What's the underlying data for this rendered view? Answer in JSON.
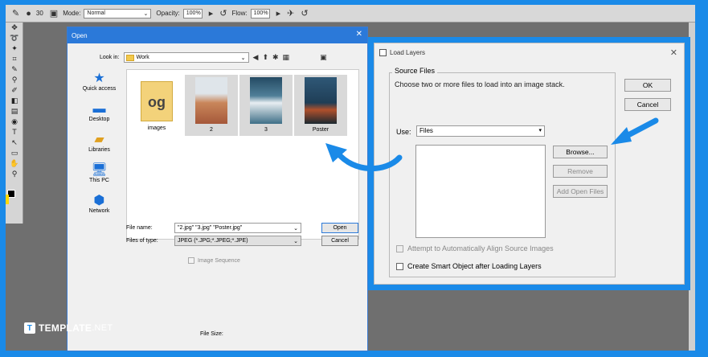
{
  "optbar": {
    "brush_size": "30",
    "mode_label": "Mode:",
    "mode_value": "Normal",
    "opacity_label": "Opacity:",
    "opacity_value": "100%",
    "flow_label": "Flow:",
    "flow_value": "100%"
  },
  "open_dialog": {
    "title": "Open",
    "close_glyph": "✕",
    "look_in_label": "Look in:",
    "look_in_value": "Work",
    "places": [
      {
        "label": "Quick access",
        "icon": "star-icon"
      },
      {
        "label": "Desktop",
        "icon": "desktop-icon"
      },
      {
        "label": "Libraries",
        "icon": "libraries-icon"
      },
      {
        "label": "This PC",
        "icon": "pc-icon"
      },
      {
        "label": "Network",
        "icon": "network-icon"
      }
    ],
    "files": [
      {
        "name": "images",
        "type": "folder"
      },
      {
        "name": "2",
        "type": "image",
        "color": "#c9865a"
      },
      {
        "name": "3",
        "type": "image",
        "color": "#3e6f87"
      },
      {
        "name": "Poster",
        "type": "image",
        "color": "#1f3e56"
      }
    ],
    "folder_glyph": "og",
    "file_name_label": "File name:",
    "file_name_value": "\"2.jpg\" \"3.jpg\" \"Poster.jpg\"",
    "file_type_label": "Files of type:",
    "file_type_value": "JPEG (*.JPG;*.JPEG;*.JPE)",
    "open_button": "Open",
    "cancel_button": "Cancel",
    "image_sequence_label": "Image Sequence",
    "file_size_label": "File Size:"
  },
  "load_layers": {
    "title": "Load Layers",
    "group_label": "Source Files",
    "instruction": "Choose two or more files to load into an image stack.",
    "use_label": "Use:",
    "use_value": "Files",
    "browse_button": "Browse...",
    "remove_button": "Remove",
    "add_open_files_button": "Add Open Files",
    "ok_button": "OK",
    "cancel_button": "Cancel",
    "align_label": "Attempt to Automatically Align Source Images",
    "smart_object_label": "Create Smart Object after Loading Layers"
  },
  "branding": {
    "logo_text": "TEMPLATE",
    "logo_suffix": ".NET"
  },
  "colors": {
    "frame_blue": "#1a8ae8",
    "title_blue": "#2b79d9"
  }
}
